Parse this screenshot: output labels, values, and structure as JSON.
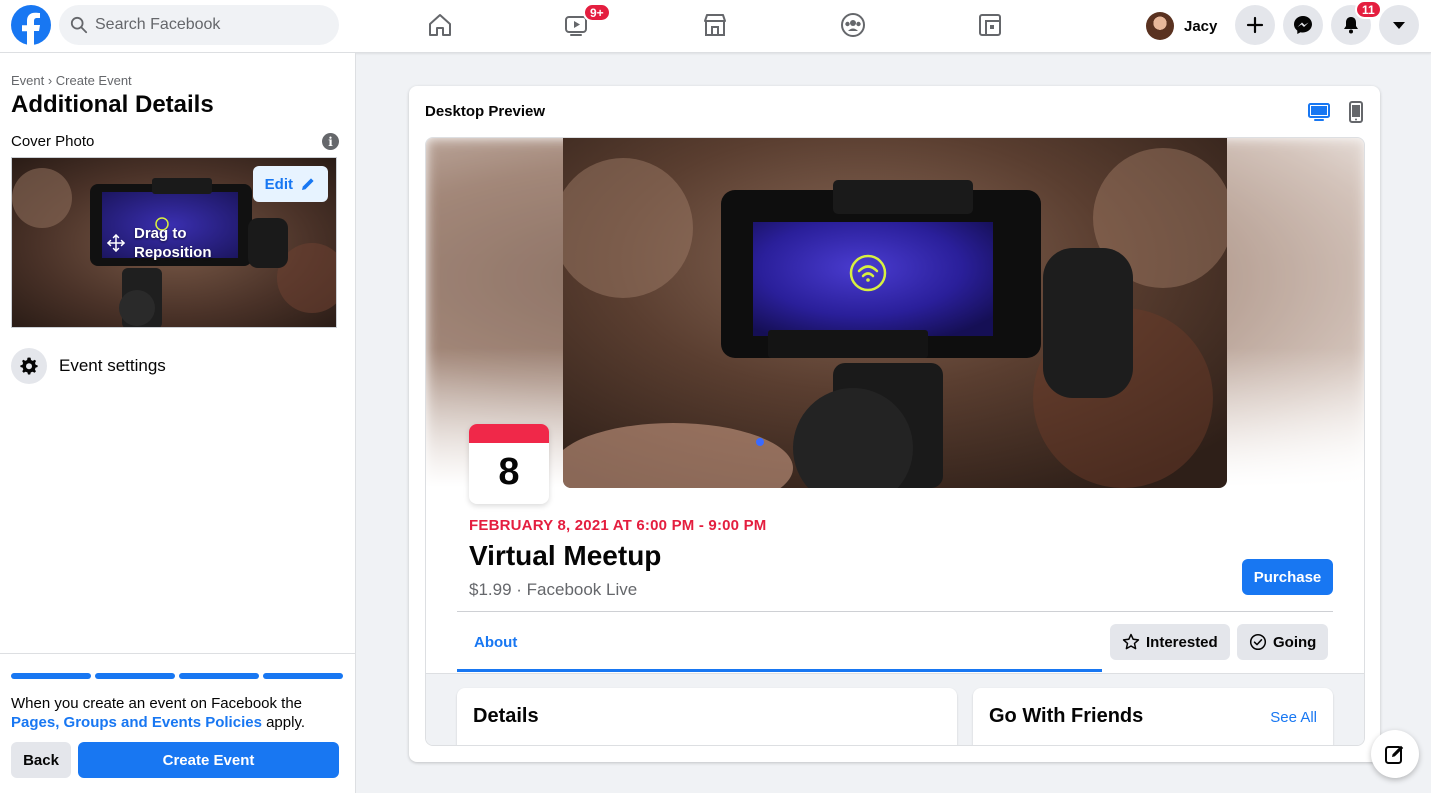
{
  "topbar": {
    "search_placeholder": "Search Facebook",
    "watch_badge": "9+",
    "profile_name": "Jacy",
    "notifications_badge": "11"
  },
  "left_panel": {
    "breadcrumb": "Event › Create Event",
    "title": "Additional Details",
    "cover_label": "Cover Photo",
    "edit_label": "Edit",
    "drag_hint": "Drag to Reposition",
    "event_settings_label": "Event settings",
    "progress_steps": 4,
    "policy_prefix": "When you create an event on Facebook the ",
    "policy_link": "Pages, Groups and Events Policies",
    "policy_suffix": " apply.",
    "back_label": "Back",
    "create_label": "Create Event"
  },
  "preview": {
    "title": "Desktop Preview",
    "calendar_day": "8",
    "date_line": "FEBRUARY 8, 2021 AT 6:00 PM - 9:00 PM",
    "event_name": "Virtual Meetup",
    "subline": "$1.99 · Facebook Live",
    "purchase_label": "Purchase",
    "tab_about": "About",
    "interested_label": "Interested",
    "going_label": "Going",
    "details_heading": "Details",
    "friends_heading": "Go With Friends",
    "see_all_label": "See All"
  },
  "colors": {
    "accent": "#1877f2",
    "date_red": "#e41e3f",
    "badge_red": "#e41e3f"
  }
}
